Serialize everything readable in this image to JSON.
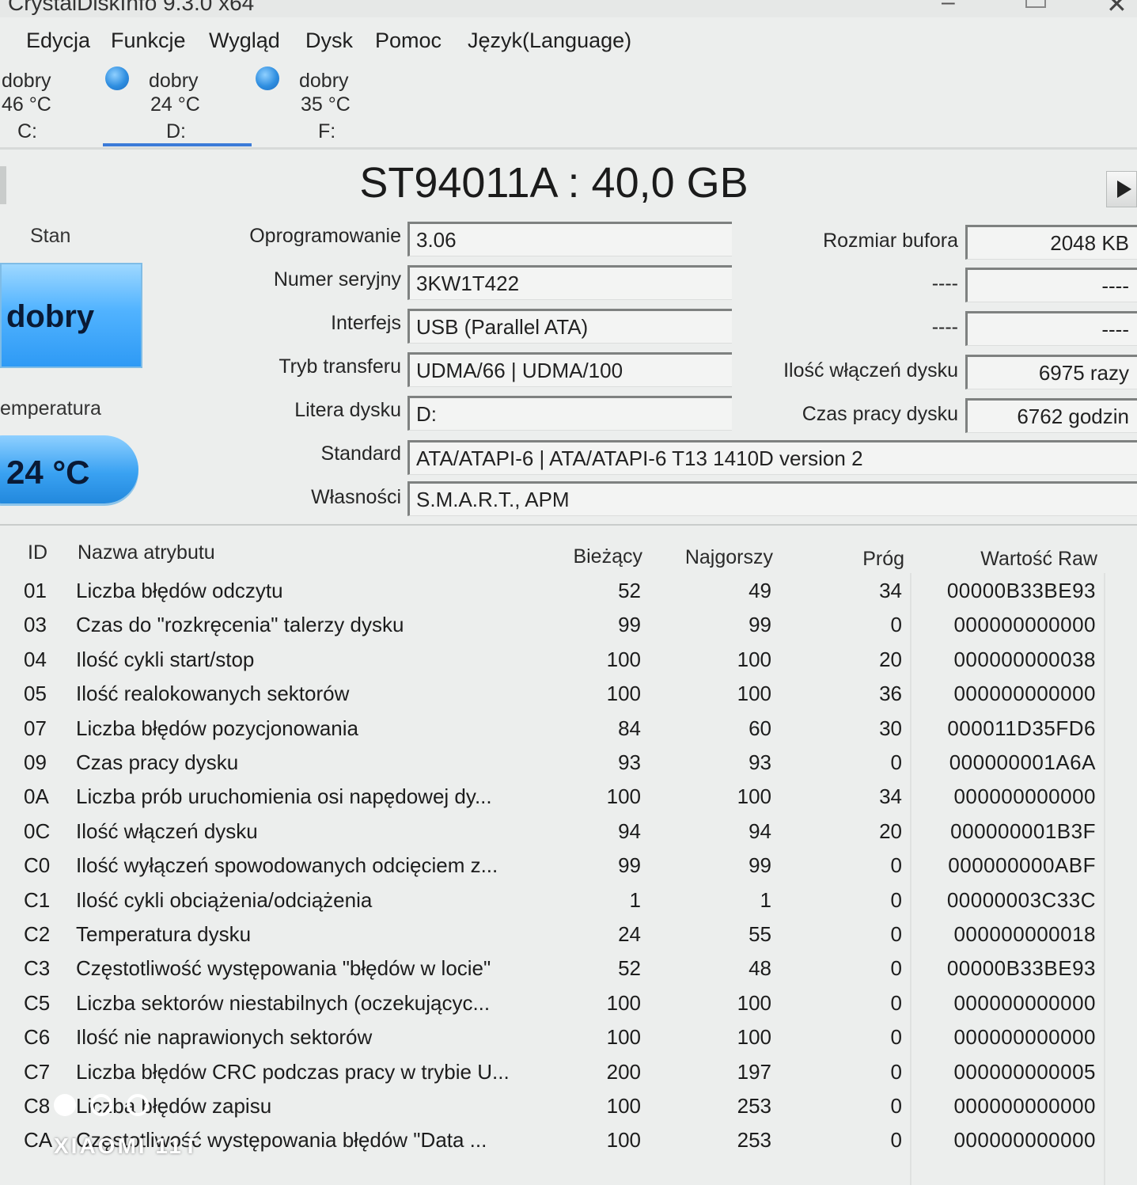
{
  "window": {
    "title": "CrystalDiskInfo 9.3.0 x64"
  },
  "menu": [
    "Edycja",
    "Funkcje",
    "Wygląd",
    "Dysk",
    "Pomoc",
    "Język(Language)"
  ],
  "drives": [
    {
      "status": "dobry",
      "temp": "46 °C",
      "letter": "C:"
    },
    {
      "status": "dobry",
      "temp": "24 °C",
      "letter": "D:"
    },
    {
      "status": "dobry",
      "temp": "35 °C",
      "letter": "F:"
    }
  ],
  "header": {
    "model": "ST94011A : 40,0 GB"
  },
  "status": {
    "stan_label": "Stan",
    "health": "dobry",
    "temp_label": "emperatura",
    "temp": "24 °C"
  },
  "info": {
    "firmware": {
      "label": "Oprogramowanie",
      "value": "3.06"
    },
    "serial": {
      "label": "Numer seryjny",
      "value": "3KW1T422"
    },
    "interface": {
      "label": "Interfejs",
      "value": "USB (Parallel ATA)"
    },
    "transfer": {
      "label": "Tryb transferu",
      "value": "UDMA/66 | UDMA/100"
    },
    "letter": {
      "label": "Litera dysku",
      "value": "D:"
    },
    "standard": {
      "label": "Standard",
      "value": "ATA/ATAPI-6 | ATA/ATAPI-6 T13 1410D version 2"
    },
    "features": {
      "label": "Własności",
      "value": "S.M.A.R.T., APM"
    },
    "buffer": {
      "label": "Rozmiar bufora",
      "value": "2048 KB"
    },
    "blank1": {
      "label": "----",
      "value": "----"
    },
    "blank2": {
      "label": "----",
      "value": "----"
    },
    "power_count": {
      "label": "Ilość włączeń dysku",
      "value": "6975 razy"
    },
    "power_hours": {
      "label": "Czas pracy dysku",
      "value": "6762 godzin"
    }
  },
  "table": {
    "headers": {
      "id": "ID",
      "name": "Nazwa atrybutu",
      "current": "Bieżący",
      "worst": "Najgorszy",
      "threshold": "Próg",
      "raw": "Wartość Raw"
    },
    "rows": [
      {
        "id": "01",
        "name": "Liczba błędów odczytu",
        "current": "52",
        "worst": "49",
        "threshold": "34",
        "raw": "00000B33BE93"
      },
      {
        "id": "03",
        "name": "Czas do \"rozkręcenia\" talerzy dysku",
        "current": "99",
        "worst": "99",
        "threshold": "0",
        "raw": "000000000000"
      },
      {
        "id": "04",
        "name": "Ilość cykli start/stop",
        "current": "100",
        "worst": "100",
        "threshold": "20",
        "raw": "000000000038"
      },
      {
        "id": "05",
        "name": "Ilość realokowanych sektorów",
        "current": "100",
        "worst": "100",
        "threshold": "36",
        "raw": "000000000000"
      },
      {
        "id": "07",
        "name": "Liczba błędów pozycjonowania",
        "current": "84",
        "worst": "60",
        "threshold": "30",
        "raw": "000011D35FD6"
      },
      {
        "id": "09",
        "name": "Czas pracy dysku",
        "current": "93",
        "worst": "93",
        "threshold": "0",
        "raw": "000000001A6A"
      },
      {
        "id": "0A",
        "name": "Liczba prób uruchomienia osi napędowej dy...",
        "current": "100",
        "worst": "100",
        "threshold": "34",
        "raw": "000000000000"
      },
      {
        "id": "0C",
        "name": "Ilość włączeń dysku",
        "current": "94",
        "worst": "94",
        "threshold": "20",
        "raw": "000000001B3F"
      },
      {
        "id": "C0",
        "name": "Ilość wyłączeń spowodowanych odcięciem z...",
        "current": "99",
        "worst": "99",
        "threshold": "0",
        "raw": "000000000ABF"
      },
      {
        "id": "C1",
        "name": "Ilość cykli obciążenia/odciążenia",
        "current": "1",
        "worst": "1",
        "threshold": "0",
        "raw": "00000003C33C"
      },
      {
        "id": "C2",
        "name": "Temperatura dysku",
        "current": "24",
        "worst": "55",
        "threshold": "0",
        "raw": "000000000018"
      },
      {
        "id": "C3",
        "name": "Częstotliwość występowania \"błędów w locie\"",
        "current": "52",
        "worst": "48",
        "threshold": "0",
        "raw": "00000B33BE93"
      },
      {
        "id": "C5",
        "name": "Liczba sektorów niestabilnych (oczekującyc...",
        "current": "100",
        "worst": "100",
        "threshold": "0",
        "raw": "000000000000"
      },
      {
        "id": "C6",
        "name": "Ilość nie naprawionych sektorów",
        "current": "100",
        "worst": "100",
        "threshold": "0",
        "raw": "000000000000"
      },
      {
        "id": "C7",
        "name": "Liczba błędów CRC podczas pracy w trybie U...",
        "current": "200",
        "worst": "197",
        "threshold": "0",
        "raw": "000000000005"
      },
      {
        "id": "C8",
        "name": "Liczba błędów zapisu",
        "current": "100",
        "worst": "253",
        "threshold": "0",
        "raw": "000000000000"
      },
      {
        "id": "CA",
        "name": "Częstotliwość występowania błędów \"Data ...",
        "current": "100",
        "worst": "253",
        "threshold": "0",
        "raw": "000000000000"
      }
    ]
  },
  "watermark": {
    "text": "XIAOMI 11T"
  },
  "colors": {
    "health_blue": "#3aa2f2",
    "tab_underline": "#3b7bd8",
    "background": "#eceeed"
  }
}
